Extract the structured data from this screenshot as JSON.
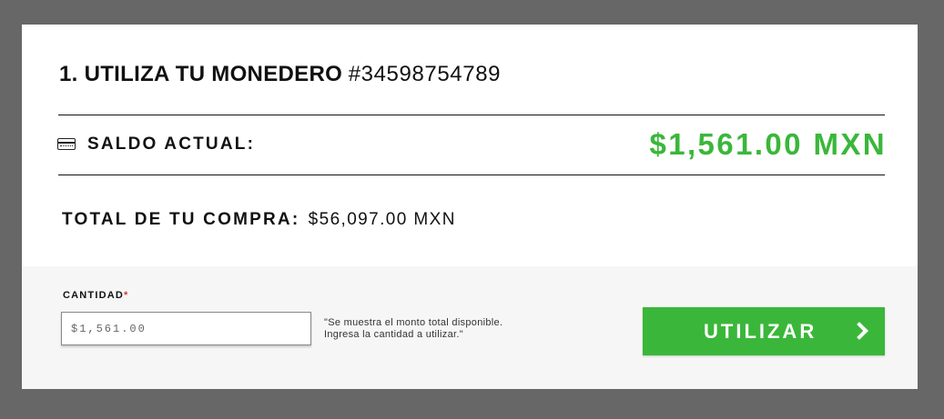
{
  "header": {
    "title": "1. UTILIZA TU MONEDERO",
    "wallet_number": "#34598754789"
  },
  "balance": {
    "label": "SALDO ACTUAL:",
    "amount": "$1,561.00 MXN",
    "icon": "credit-card-icon"
  },
  "total": {
    "label": "TOTAL DE TU COMPRA:",
    "amount": "$56,097.00 MXN"
  },
  "form": {
    "quantity_label": "CANTIDAD",
    "required_mark": "*",
    "quantity_placeholder": "$1,561.00",
    "hint_line1": "\"Se muestra el monto total disponible.",
    "hint_line2": "Ingresa la cantidad a utilizar.\"",
    "submit_label": "UTILIZAR"
  },
  "colors": {
    "accent": "#3ab73a",
    "backdrop": "#676767",
    "panel": "#f6f6f6",
    "required": "#d33333"
  }
}
